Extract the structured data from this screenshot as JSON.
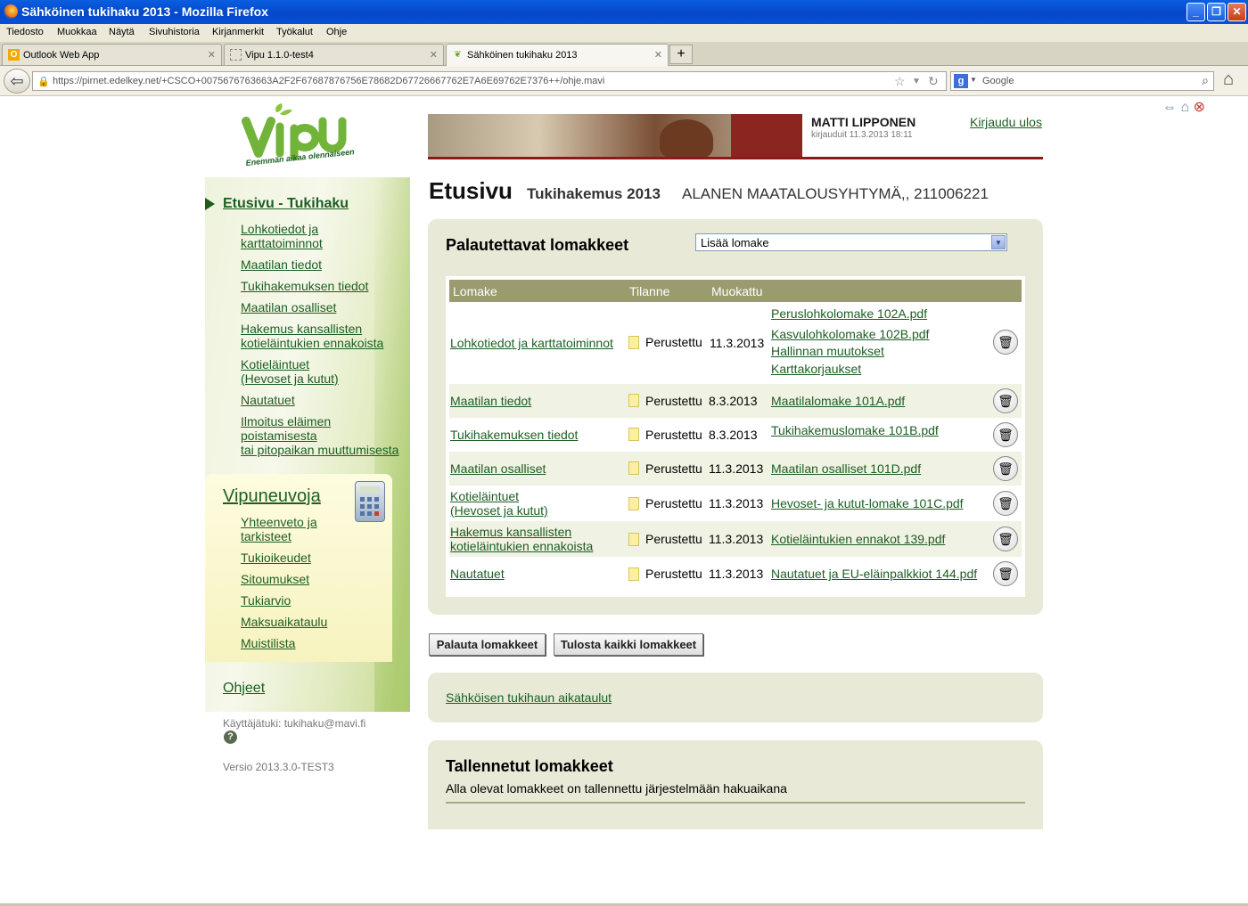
{
  "window": {
    "title": "Sähköinen tukihaku 2013 - Mozilla Firefox"
  },
  "menu": [
    "Tiedosto",
    "Muokkaa",
    "Näytä",
    "Sivuhistoria",
    "Kirjanmerkit",
    "Työkalut",
    "Ohje"
  ],
  "tabs": [
    {
      "label": "Outlook Web App"
    },
    {
      "label": "Vipu 1.1.0-test4"
    },
    {
      "label": "Sähköinen tukihaku 2013"
    }
  ],
  "url": "https://pirnet.edelkey.net/+CSCO+0075676763663A2F2F67687876756E78682D67726667762E7A6E69762E7376++/ohje.mavi",
  "search_placeholder": "Google",
  "logo": {
    "main": "vipu",
    "tagline": "Enemmän aikaa olennaiseen"
  },
  "user": {
    "name": "MATTI LIPPONEN",
    "login_time": "kirjauduit 11.3.2013 18:11",
    "logout": "Kirjaudu ulos"
  },
  "sidebar": {
    "active": "Etusivu - Tukihaku",
    "items": [
      [
        "Lohkotiedot ja",
        "karttatoiminnot"
      ],
      [
        "Maatilan tiedot"
      ],
      [
        "Tukihakemuksen tiedot"
      ],
      [
        "Maatilan osalliset"
      ],
      [
        "Hakemus kansallisten",
        "kotieläintukien ennakoista"
      ],
      [
        "Kotieläintuet",
        "(Hevoset ja kutut)"
      ],
      [
        "Nautatuet"
      ],
      [
        "Ilmoitus eläimen",
        "poistamisesta",
        "tai pitopaikan muuttumisesta"
      ]
    ],
    "tools_title": "Vipuneuvoja",
    "tools": [
      [
        "Yhteenveto ja",
        "tarkisteet"
      ],
      [
        "Tukioikeudet"
      ],
      [
        "Sitoumukset"
      ],
      [
        "Tukiarvio"
      ],
      [
        "Maksuaikataulu"
      ],
      [
        "Muistilista"
      ]
    ],
    "help": "Ohjeet",
    "support": "Käyttäjätuki: tukihaku@mavi.fi",
    "version": "Versio 2013.3.0-TEST3"
  },
  "heading": {
    "main": "Etusivu",
    "sub": "Tukihakemus 2013",
    "farm": "ALANEN MAATALOUSYHTYMÄ,, 211006221"
  },
  "forms_panel": {
    "title": "Palautettavat lomakkeet",
    "dropdown": "Lisää lomake",
    "columns": [
      "Lomake",
      "Tilanne",
      "Muokattu"
    ],
    "rows": [
      {
        "name": [
          "Lohkotiedot ja karttatoiminnot"
        ],
        "status": "Perustettu",
        "date": "11.3.2013",
        "files": [
          "Peruslohkolomake 102A.pdf",
          "Kasvulohkolomake 102B.pdf",
          "Hallinnan muutokset",
          "Karttakorjaukset"
        ]
      },
      {
        "name": [
          "Maatilan tiedot"
        ],
        "status": "Perustettu",
        "date": "8.3.2013",
        "files": [
          "Maatilalomake 101A.pdf"
        ]
      },
      {
        "name": [
          "Tukihakemuksen tiedot"
        ],
        "status": "Perustettu",
        "date": "8.3.2013",
        "files": [
          "Tukihakemuslomake 101B.pdf"
        ]
      },
      {
        "name": [
          "Maatilan osalliset"
        ],
        "status": "Perustettu",
        "date": "11.3.2013",
        "files": [
          "Maatilan osalliset 101D.pdf"
        ]
      },
      {
        "name": [
          "Kotieläintuet",
          "(Hevoset ja kutut)"
        ],
        "status": "Perustettu",
        "date": "11.3.2013",
        "files": [
          "Hevoset- ja kutut-lomake 101C.pdf"
        ]
      },
      {
        "name": [
          "Hakemus kansallisten",
          "kotieläintukien ennakoista"
        ],
        "status": "Perustettu",
        "date": "11.3.2013",
        "files": [
          "Kotieläintukien ennakot 139.pdf"
        ]
      },
      {
        "name": [
          "Nautatuet"
        ],
        "status": "Perustettu",
        "date": "11.3.2013",
        "files": [
          "Nautatuet ja EU-eläinpalkkiot 144.pdf"
        ]
      }
    ]
  },
  "buttons": {
    "return": "Palauta lomakkeet",
    "print": "Tulosta kaikki lomakkeet"
  },
  "schedule_link": "Sähköisen tukihaun aikataulut",
  "saved": {
    "title": "Tallennetut lomakkeet",
    "subtitle": "Alla olevat lomakkeet on tallennettu järjestelmään hakuaikana"
  }
}
